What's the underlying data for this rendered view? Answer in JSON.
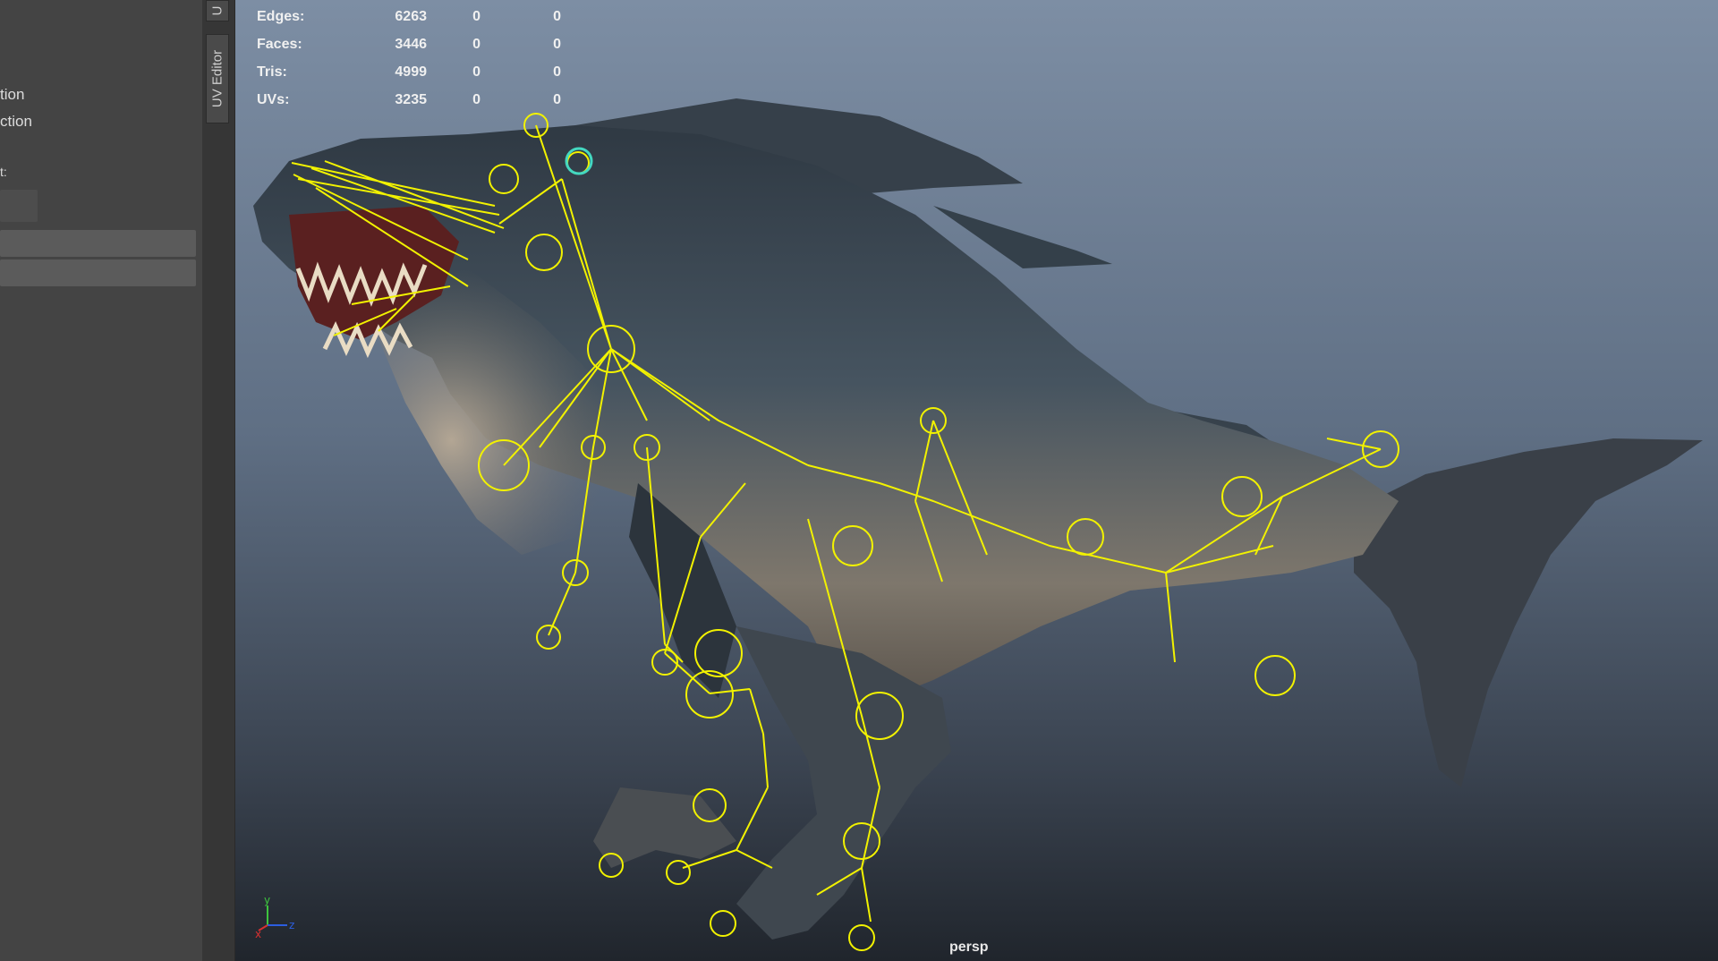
{
  "left_panel": {
    "items": [
      "tion",
      "ction",
      "t:"
    ]
  },
  "side_tabs": {
    "top_tab": "U",
    "uv_editor": "UV Editor"
  },
  "hud": {
    "rows": [
      {
        "label": "Edges:",
        "v1": "6263",
        "v2": "0",
        "v3": "0"
      },
      {
        "label": "Faces:",
        "v1": "3446",
        "v2": "0",
        "v3": "0"
      },
      {
        "label": "Tris:",
        "v1": "4999",
        "v2": "0",
        "v3": "0"
      },
      {
        "label": "UVs:",
        "v1": "3235",
        "v2": "0",
        "v3": "0"
      }
    ]
  },
  "viewport": {
    "camera_label": "persp",
    "axis": {
      "x": "x",
      "y": "y",
      "z": "z"
    }
  },
  "colors": {
    "rig": "#f2f200",
    "selected_joint": "#44d8c0",
    "shark_back": "#3e4852",
    "shark_belly": "#9a8e80",
    "mouth": "#5a2020"
  }
}
